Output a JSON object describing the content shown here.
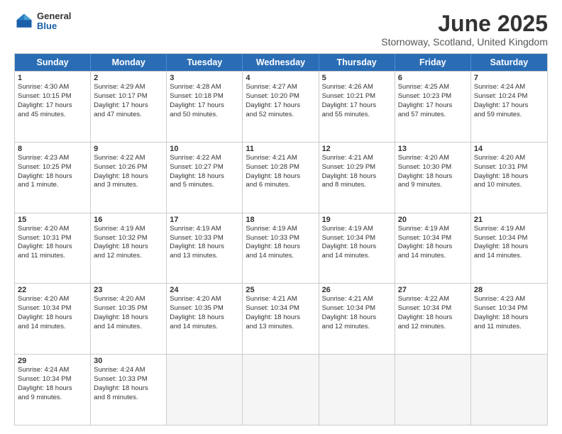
{
  "header": {
    "logo": {
      "general": "General",
      "blue": "Blue"
    },
    "title": "June 2025",
    "location": "Stornoway, Scotland, United Kingdom"
  },
  "weekdays": [
    "Sunday",
    "Monday",
    "Tuesday",
    "Wednesday",
    "Thursday",
    "Friday",
    "Saturday"
  ],
  "rows": [
    [
      {
        "day": "1",
        "info": "Sunrise: 4:30 AM\nSunset: 10:15 PM\nDaylight: 17 hours\nand 45 minutes."
      },
      {
        "day": "2",
        "info": "Sunrise: 4:29 AM\nSunset: 10:17 PM\nDaylight: 17 hours\nand 47 minutes."
      },
      {
        "day": "3",
        "info": "Sunrise: 4:28 AM\nSunset: 10:18 PM\nDaylight: 17 hours\nand 50 minutes."
      },
      {
        "day": "4",
        "info": "Sunrise: 4:27 AM\nSunset: 10:20 PM\nDaylight: 17 hours\nand 52 minutes."
      },
      {
        "day": "5",
        "info": "Sunrise: 4:26 AM\nSunset: 10:21 PM\nDaylight: 17 hours\nand 55 minutes."
      },
      {
        "day": "6",
        "info": "Sunrise: 4:25 AM\nSunset: 10:23 PM\nDaylight: 17 hours\nand 57 minutes."
      },
      {
        "day": "7",
        "info": "Sunrise: 4:24 AM\nSunset: 10:24 PM\nDaylight: 17 hours\nand 59 minutes."
      }
    ],
    [
      {
        "day": "8",
        "info": "Sunrise: 4:23 AM\nSunset: 10:25 PM\nDaylight: 18 hours\nand 1 minute."
      },
      {
        "day": "9",
        "info": "Sunrise: 4:22 AM\nSunset: 10:26 PM\nDaylight: 18 hours\nand 3 minutes."
      },
      {
        "day": "10",
        "info": "Sunrise: 4:22 AM\nSunset: 10:27 PM\nDaylight: 18 hours\nand 5 minutes."
      },
      {
        "day": "11",
        "info": "Sunrise: 4:21 AM\nSunset: 10:28 PM\nDaylight: 18 hours\nand 6 minutes."
      },
      {
        "day": "12",
        "info": "Sunrise: 4:21 AM\nSunset: 10:29 PM\nDaylight: 18 hours\nand 8 minutes."
      },
      {
        "day": "13",
        "info": "Sunrise: 4:20 AM\nSunset: 10:30 PM\nDaylight: 18 hours\nand 9 minutes."
      },
      {
        "day": "14",
        "info": "Sunrise: 4:20 AM\nSunset: 10:31 PM\nDaylight: 18 hours\nand 10 minutes."
      }
    ],
    [
      {
        "day": "15",
        "info": "Sunrise: 4:20 AM\nSunset: 10:31 PM\nDaylight: 18 hours\nand 11 minutes."
      },
      {
        "day": "16",
        "info": "Sunrise: 4:19 AM\nSunset: 10:32 PM\nDaylight: 18 hours\nand 12 minutes."
      },
      {
        "day": "17",
        "info": "Sunrise: 4:19 AM\nSunset: 10:33 PM\nDaylight: 18 hours\nand 13 minutes."
      },
      {
        "day": "18",
        "info": "Sunrise: 4:19 AM\nSunset: 10:33 PM\nDaylight: 18 hours\nand 14 minutes."
      },
      {
        "day": "19",
        "info": "Sunrise: 4:19 AM\nSunset: 10:34 PM\nDaylight: 18 hours\nand 14 minutes."
      },
      {
        "day": "20",
        "info": "Sunrise: 4:19 AM\nSunset: 10:34 PM\nDaylight: 18 hours\nand 14 minutes."
      },
      {
        "day": "21",
        "info": "Sunrise: 4:19 AM\nSunset: 10:34 PM\nDaylight: 18 hours\nand 14 minutes."
      }
    ],
    [
      {
        "day": "22",
        "info": "Sunrise: 4:20 AM\nSunset: 10:34 PM\nDaylight: 18 hours\nand 14 minutes."
      },
      {
        "day": "23",
        "info": "Sunrise: 4:20 AM\nSunset: 10:35 PM\nDaylight: 18 hours\nand 14 minutes."
      },
      {
        "day": "24",
        "info": "Sunrise: 4:20 AM\nSunset: 10:35 PM\nDaylight: 18 hours\nand 14 minutes."
      },
      {
        "day": "25",
        "info": "Sunrise: 4:21 AM\nSunset: 10:34 PM\nDaylight: 18 hours\nand 13 minutes."
      },
      {
        "day": "26",
        "info": "Sunrise: 4:21 AM\nSunset: 10:34 PM\nDaylight: 18 hours\nand 12 minutes."
      },
      {
        "day": "27",
        "info": "Sunrise: 4:22 AM\nSunset: 10:34 PM\nDaylight: 18 hours\nand 12 minutes."
      },
      {
        "day": "28",
        "info": "Sunrise: 4:23 AM\nSunset: 10:34 PM\nDaylight: 18 hours\nand 11 minutes."
      }
    ],
    [
      {
        "day": "29",
        "info": "Sunrise: 4:24 AM\nSunset: 10:34 PM\nDaylight: 18 hours\nand 9 minutes."
      },
      {
        "day": "30",
        "info": "Sunrise: 4:24 AM\nSunset: 10:33 PM\nDaylight: 18 hours\nand 8 minutes."
      },
      {
        "day": "",
        "info": ""
      },
      {
        "day": "",
        "info": ""
      },
      {
        "day": "",
        "info": ""
      },
      {
        "day": "",
        "info": ""
      },
      {
        "day": "",
        "info": ""
      }
    ]
  ]
}
